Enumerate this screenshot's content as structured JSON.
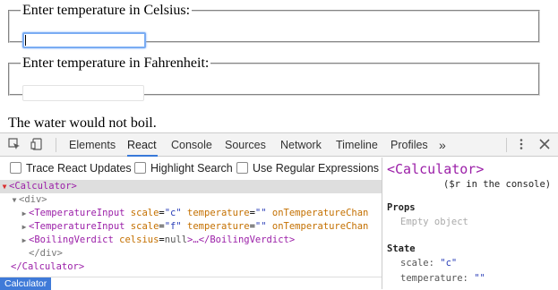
{
  "app": {
    "celsius_legend": "Enter temperature in Celsius:",
    "celsius_value": "",
    "fahrenheit_legend": "Enter temperature in Fahrenheit:",
    "fahrenheit_value": "",
    "verdict": "The water would not boil."
  },
  "devtools": {
    "tabs": [
      "Elements",
      "React",
      "Console",
      "Sources",
      "Network",
      "Timeline",
      "Profiles"
    ],
    "active_tab": "React",
    "more_tabs": "»",
    "icons": [
      "inspect-icon",
      "device-icon",
      "kebab-menu-icon",
      "close-icon"
    ],
    "options": [
      {
        "label": "Trace React Updates",
        "checked": false
      },
      {
        "label": "Highlight Search",
        "checked": false
      },
      {
        "label": "Use Regular Expressions",
        "checked": false
      }
    ],
    "tree": {
      "root_open": "<Calculator>",
      "div_open": "<div>",
      "row1": {
        "tag": "<TemperatureInput",
        "a1": "scale",
        "v1": "\"c\"",
        "a2": "temperature",
        "v2": "\"\"",
        "a3": "onTemperatureChan"
      },
      "row2": {
        "tag": "<TemperatureInput",
        "a1": "scale",
        "v1": "\"f\"",
        "a2": "temperature",
        "v2": "\"\"",
        "a3": "onTemperatureChan"
      },
      "row3": {
        "tag": "<BoilingVerdict",
        "a1": "celsius",
        "v1": "null",
        "rest": ">…</BoilingVerdict>"
      },
      "div_close": "</div>",
      "root_close": "</Calculator>"
    },
    "side": {
      "component": "<Calculator>",
      "hint": "($r in the console)",
      "props_title": "Props",
      "props_empty": "Empty object",
      "state_title": "State",
      "state": [
        {
          "key": "scale:",
          "value": "\"c\""
        },
        {
          "key": "temperature:",
          "value": "\"\""
        }
      ]
    },
    "breadcrumb": "Calculator"
  },
  "colors": {
    "accent": "#3879d9",
    "tag": "#9b1fa8",
    "attr_name": "#c47000",
    "value": "#2b3fb8",
    "selected_row": "#dedede"
  }
}
